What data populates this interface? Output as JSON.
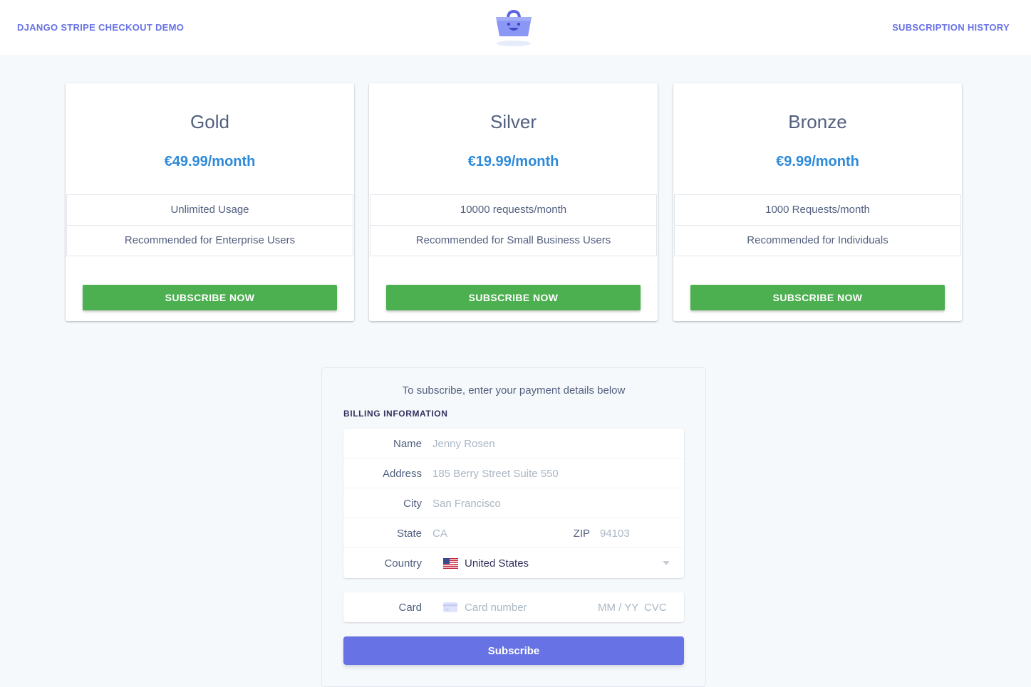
{
  "header": {
    "brand": "DJANGO STRIPE CHECKOUT DEMO",
    "history_link": "SUBSCRIPTION HISTORY",
    "logo_icon": "shopping-basket-icon",
    "accent_color": "#6772e5"
  },
  "plans": [
    {
      "name": "Gold",
      "price": "€49.99/month",
      "features": [
        "Unlimited Usage",
        "Recommended for Enterprise Users"
      ],
      "button": "SUBSCRIBE NOW"
    },
    {
      "name": "Silver",
      "price": "€19.99/month",
      "features": [
        "10000 requests/month",
        "Recommended for Small Business Users"
      ],
      "button": "SUBSCRIBE NOW"
    },
    {
      "name": "Bronze",
      "price": "€9.99/month",
      "features": [
        "1000 Requests/month",
        "Recommended for Individuals"
      ],
      "button": "SUBSCRIBE NOW"
    }
  ],
  "payment": {
    "intro": "To subscribe, enter your payment details below",
    "billing_title": "BILLING INFORMATION",
    "fields": {
      "name": {
        "label": "Name",
        "placeholder": "Jenny Rosen",
        "value": ""
      },
      "address": {
        "label": "Address",
        "placeholder": "185 Berry Street Suite 550",
        "value": ""
      },
      "city": {
        "label": "City",
        "placeholder": "San Francisco",
        "value": ""
      },
      "state": {
        "label": "State",
        "placeholder": "CA",
        "value": ""
      },
      "zip": {
        "label": "ZIP",
        "placeholder": "94103",
        "value": ""
      },
      "country": {
        "label": "Country",
        "value": "United States",
        "flag_icon": "us-flag-icon"
      }
    },
    "card": {
      "label": "Card",
      "number_placeholder": "Card number",
      "expiry_placeholder": "MM / YY",
      "cvc_placeholder": "CVC",
      "icon": "credit-card-icon"
    },
    "submit_label": "Subscribe"
  },
  "colors": {
    "price_blue": "#2d8ad9",
    "subscribe_green": "#4caf50",
    "subscribe_purple": "#6772e5",
    "background": "#f6f9fc"
  }
}
